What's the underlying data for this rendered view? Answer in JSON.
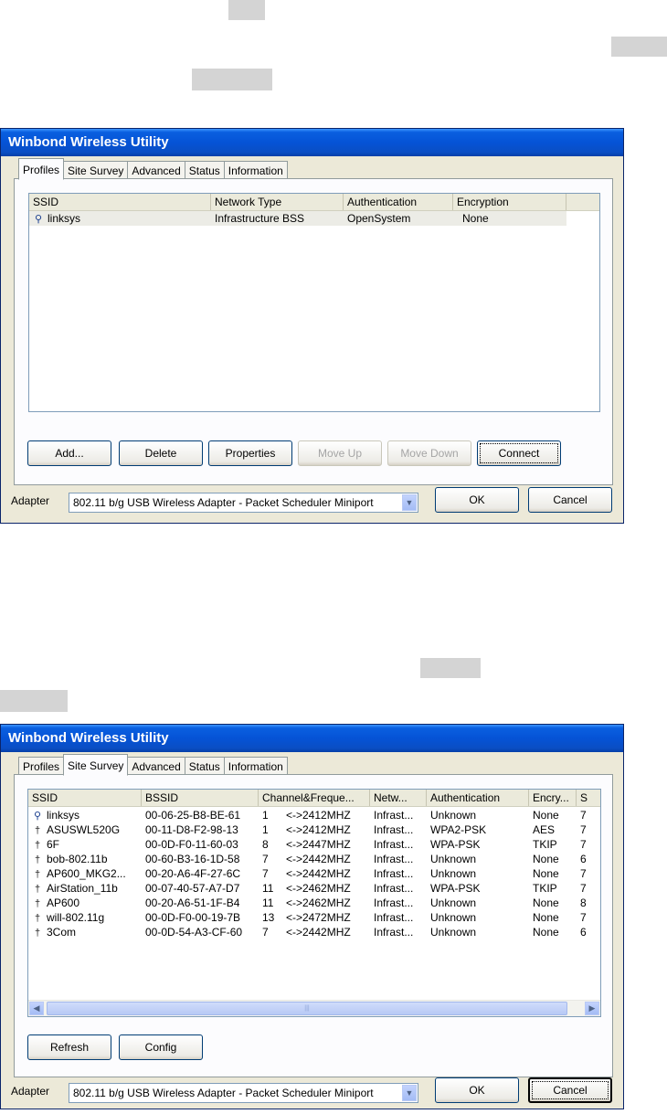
{
  "window_title": "Winbond Wireless Utility",
  "tabs": [
    "Profiles",
    "Site Survey",
    "Advanced",
    "Status",
    "Information"
  ],
  "colors": {
    "title_bar": "#0553d6",
    "dialog_bg": "#ece9d8",
    "highlight": "#d4d4d4"
  },
  "profiles_window": {
    "active_tab": "Profiles",
    "columns": [
      "SSID",
      "Network Type",
      "Authentication",
      "Encryption"
    ],
    "rows": [
      {
        "ssid": "linksys",
        "network_type": "Infrastructure BSS",
        "authentication": "OpenSystem",
        "encryption": "None",
        "icon": "connected-ap-icon"
      }
    ],
    "buttons": {
      "add": "Add...",
      "delete": "Delete",
      "properties": "Properties",
      "move_up": "Move Up",
      "move_down": "Move Down",
      "connect": "Connect"
    },
    "adapter_label": "Adapter",
    "adapter_value": "802.11 b/g USB Wireless Adapter - Packet Scheduler Miniport",
    "ok": "OK",
    "cancel": "Cancel"
  },
  "survey_window": {
    "active_tab": "Site Survey",
    "columns": [
      "SSID",
      "BSSID",
      "Channel&Freque...",
      "Netw...",
      "Authentication",
      "Encry...",
      "S"
    ],
    "rows": [
      {
        "ssid": "linksys",
        "bssid": "00-06-25-B8-BE-61",
        "channel": "1",
        "freq": "<->2412MHZ",
        "network": "Infrast...",
        "auth": "Unknown",
        "enc": "None",
        "signal": "7",
        "icon": "connected-ap-icon"
      },
      {
        "ssid": "ASUSWL520G",
        "bssid": "00-11-D8-F2-98-13",
        "channel": "1",
        "freq": "<->2412MHZ",
        "network": "Infrast...",
        "auth": "WPA2-PSK",
        "enc": "AES",
        "signal": "7",
        "icon": "access-point-icon"
      },
      {
        "ssid": "6F",
        "bssid": "00-0D-F0-11-60-03",
        "channel": "8",
        "freq": "<->2447MHZ",
        "network": "Infrast...",
        "auth": "WPA-PSK",
        "enc": "TKIP",
        "signal": "7",
        "icon": "access-point-icon"
      },
      {
        "ssid": "bob-802.11b",
        "bssid": "00-60-B3-16-1D-58",
        "channel": "7",
        "freq": "<->2442MHZ",
        "network": "Infrast...",
        "auth": "Unknown",
        "enc": "None",
        "signal": "6",
        "icon": "access-point-icon"
      },
      {
        "ssid": "AP600_MKG2...",
        "bssid": "00-20-A6-4F-27-6C",
        "channel": "7",
        "freq": "<->2442MHZ",
        "network": "Infrast...",
        "auth": "Unknown",
        "enc": "None",
        "signal": "7",
        "icon": "access-point-icon"
      },
      {
        "ssid": "AirStation_11b",
        "bssid": "00-07-40-57-A7-D7",
        "channel": "11",
        "freq": "<->2462MHZ",
        "network": "Infrast...",
        "auth": "WPA-PSK",
        "enc": "TKIP",
        "signal": "7",
        "icon": "access-point-icon"
      },
      {
        "ssid": "AP600",
        "bssid": "00-20-A6-51-1F-B4",
        "channel": "11",
        "freq": "<->2462MHZ",
        "network": "Infrast...",
        "auth": "Unknown",
        "enc": "None",
        "signal": "8",
        "icon": "access-point-icon"
      },
      {
        "ssid": "will-802.11g",
        "bssid": "00-0D-F0-00-19-7B",
        "channel": "13",
        "freq": "<->2472MHZ",
        "network": "Infrast...",
        "auth": "Unknown",
        "enc": "None",
        "signal": "7",
        "icon": "access-point-icon"
      },
      {
        "ssid": "3Com",
        "bssid": "00-0D-54-A3-CF-60",
        "channel": "7",
        "freq": "<->2442MHZ",
        "network": "Infrast...",
        "auth": "Unknown",
        "enc": "None",
        "signal": "6",
        "icon": "access-point-icon"
      }
    ],
    "buttons": {
      "refresh": "Refresh",
      "config": "Config"
    },
    "adapter_label": "Adapter",
    "adapter_value": "802.11 b/g USB Wireless Adapter - Packet Scheduler Miniport",
    "ok": "OK",
    "cancel": "Cancel"
  }
}
